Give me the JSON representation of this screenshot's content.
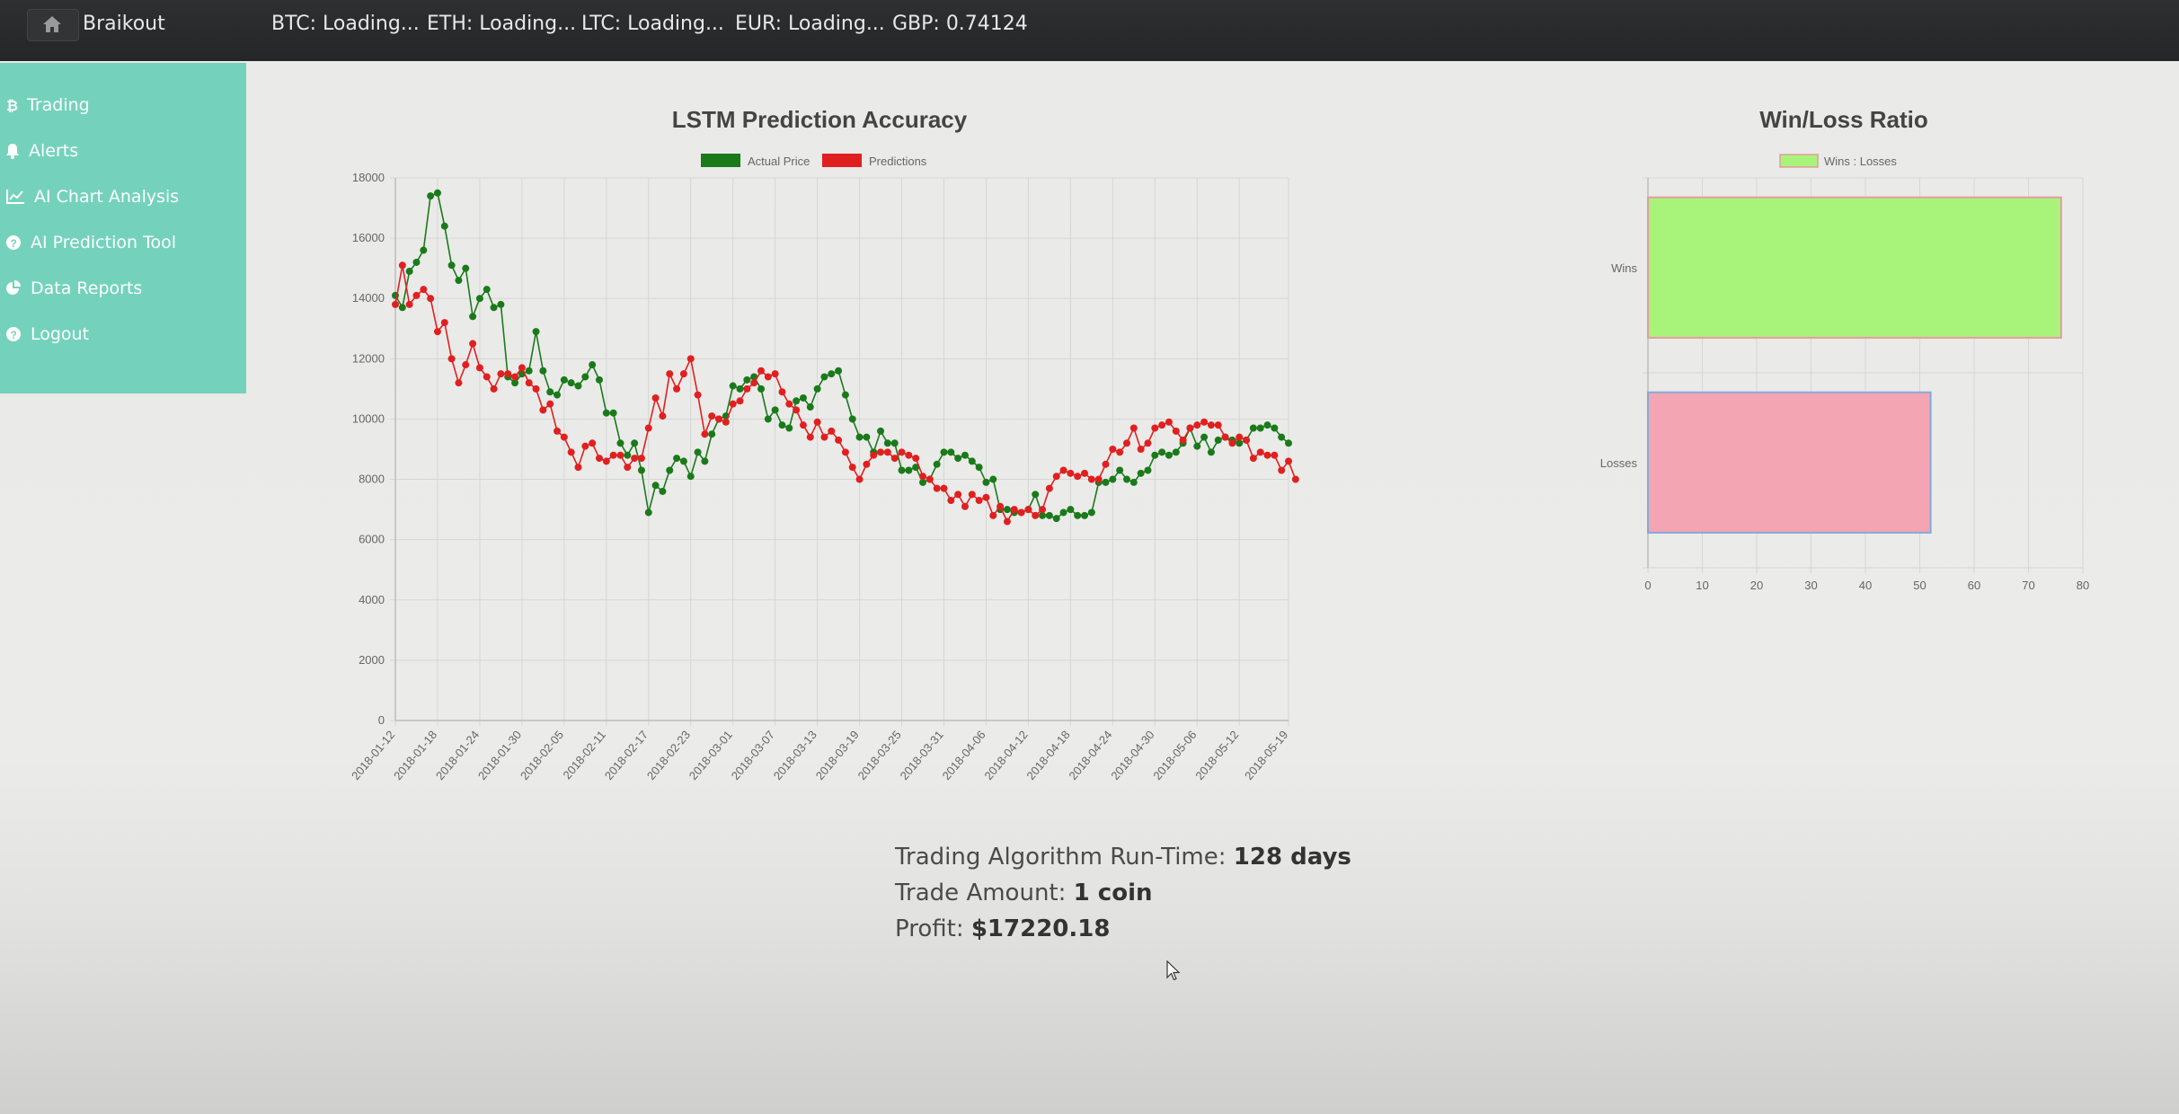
{
  "topbar": {
    "brand": "Braikout",
    "tickers": [
      "BTC: Loading...",
      "ETH: Loading...",
      "LTC: Loading...",
      "EUR: Loading...",
      "GBP: 0.74124"
    ]
  },
  "sidebar": {
    "items": [
      {
        "label": "Trading",
        "icon": "bitcoin-icon"
      },
      {
        "label": "Alerts",
        "icon": "bell-icon"
      },
      {
        "label": "AI Chart Analysis",
        "icon": "line-chart-icon"
      },
      {
        "label": "AI Prediction Tool",
        "icon": "question-circle-icon"
      },
      {
        "label": "Data Reports",
        "icon": "pie-chart-icon"
      },
      {
        "label": "Logout",
        "icon": "question-circle-icon"
      }
    ]
  },
  "stats": {
    "runtime_label": "Trading Algorithm Run-Time:",
    "runtime_value": "128 days",
    "amount_label": "Trade Amount:",
    "amount_value": "1 coin",
    "profit_label": "Profit:",
    "profit_value": "$17220.18"
  },
  "chart_data": [
    {
      "type": "line",
      "title": "LSTM Prediction Accuracy",
      "legend_position": "top",
      "grid": true,
      "ylim": [
        0,
        18000
      ],
      "yticks": [
        0,
        2000,
        4000,
        6000,
        8000,
        10000,
        12000,
        14000,
        16000,
        18000
      ],
      "x_start": "2018-01-12",
      "x_end": "2018-05-19",
      "xticks": [
        "2018-01-12",
        "2018-01-18",
        "2018-01-24",
        "2018-01-30",
        "2018-02-05",
        "2018-02-11",
        "2018-02-17",
        "2018-02-23",
        "2018-03-01",
        "2018-03-07",
        "2018-03-13",
        "2018-03-19",
        "2018-03-25",
        "2018-03-31",
        "2018-04-06",
        "2018-04-12",
        "2018-04-18",
        "2018-04-24",
        "2018-04-30",
        "2018-05-06",
        "2018-05-12",
        "2018-05-19"
      ],
      "series": [
        {
          "name": "Actual Price",
          "color": "#1a7a1a",
          "values": [
            14100,
            13700,
            14900,
            15200,
            15600,
            17400,
            17500,
            16400,
            15100,
            14600,
            15000,
            13400,
            14000,
            14300,
            13700,
            13800,
            11400,
            11200,
            11500,
            11600,
            12900,
            11600,
            10900,
            10800,
            11300,
            11200,
            11100,
            11400,
            11800,
            11300,
            10200,
            10200,
            9200,
            8800,
            9200,
            8300,
            6900,
            7800,
            7600,
            8300,
            8700,
            8600,
            8100,
            8900,
            8600,
            9500,
            10000,
            10100,
            11100,
            11000,
            11300,
            11400,
            11000,
            10000,
            10300,
            9800,
            9700,
            10600,
            10700,
            10400,
            11000,
            11400,
            11500,
            11600,
            10800,
            10000,
            9400,
            9400,
            8900,
            9600,
            9200,
            9200,
            8300,
            8300,
            8400,
            7900,
            8000,
            8500,
            8900,
            8900,
            8700,
            8800,
            8600,
            8400,
            7900,
            8000,
            7000,
            7000,
            6900,
            6900,
            7000,
            7500,
            6800,
            6800,
            6700,
            6900,
            7000,
            6800,
            6800,
            6900,
            7900,
            7900,
            8000,
            8300,
            8000,
            7900,
            8200,
            8300,
            8800,
            8900,
            8800,
            8900,
            9200,
            9700,
            9100,
            9400,
            8900,
            9300,
            9400,
            9300,
            9200,
            9300,
            9700,
            9700,
            9800,
            9700,
            9400,
            9200
          ]
        },
        {
          "name": "Predictions",
          "color": "#e02020",
          "values": [
            13800,
            15100,
            13800,
            14100,
            14300,
            14000,
            12900,
            13200,
            12000,
            11200,
            11800,
            12500,
            11700,
            11400,
            11000,
            11500,
            11500,
            11400,
            11700,
            11200,
            11000,
            10300,
            10500,
            9600,
            9400,
            8900,
            8400,
            9100,
            9200,
            8700,
            8600,
            8800,
            8800,
            8400,
            8700,
            8700,
            9700,
            10700,
            10100,
            11500,
            11000,
            11500,
            12000,
            10800,
            9500,
            10100,
            10000,
            9900,
            10500,
            10600,
            11000,
            11200,
            11600,
            11400,
            11500,
            10900,
            10500,
            10300,
            9800,
            9400,
            9900,
            9400,
            9600,
            9300,
            8900,
            8400,
            8000,
            8500,
            8800,
            8900,
            8900,
            8700,
            8900,
            8800,
            8700,
            8100,
            8000,
            7700,
            7700,
            7300,
            7500,
            7100,
            7500,
            7300,
            7400,
            6800,
            7100,
            6600,
            7000,
            6900,
            7000,
            6800,
            7000,
            7700,
            8100,
            8300,
            8200,
            8100,
            8200,
            8000,
            8000,
            8500,
            9000,
            8900,
            9200,
            9700,
            9000,
            9200,
            9700,
            9800,
            9900,
            9600,
            9300,
            9700,
            9800,
            9900,
            9800,
            9800,
            9400,
            9200,
            9400,
            9300,
            8700,
            8900,
            8800,
            8800,
            8300,
            8600,
            8000
          ]
        }
      ]
    },
    {
      "type": "bar",
      "orientation": "horizontal",
      "title": "Win/Loss Ratio",
      "legend_position": "top",
      "grid": true,
      "categories": [
        "Wins",
        "Losses"
      ],
      "xlim": [
        0,
        80
      ],
      "xticks": [
        0,
        10,
        20,
        30,
        40,
        50,
        60,
        70,
        80
      ],
      "series": [
        {
          "name": "Wins : Losses",
          "values": [
            76,
            52
          ],
          "colors": [
            "#a8f47a",
            "#f3a5b4"
          ],
          "borders": [
            "#e59ba0",
            "#86a9d9"
          ]
        }
      ]
    }
  ]
}
